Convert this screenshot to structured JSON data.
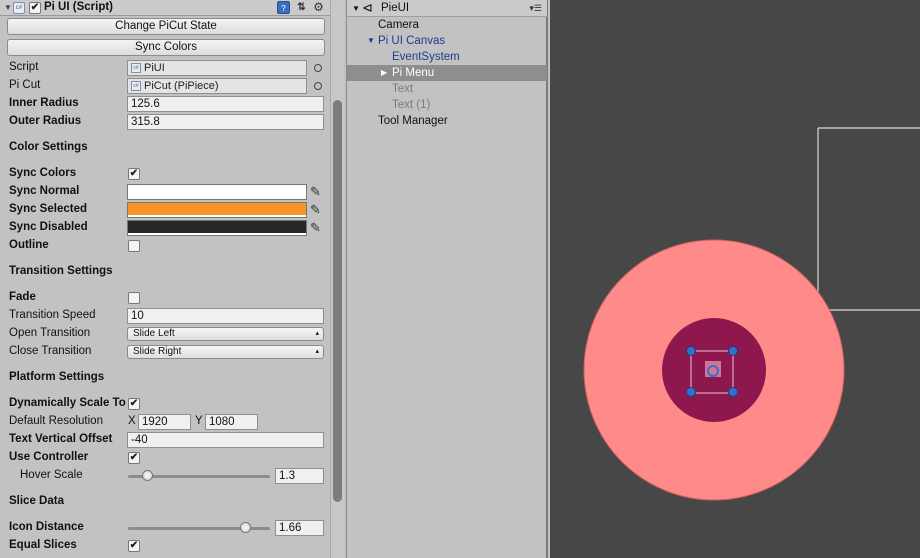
{
  "inspector": {
    "component_title": "Pi UI (Script)",
    "buttons": {
      "change_state": "Change PiCut State",
      "sync_colors": "Sync Colors"
    },
    "script": {
      "label": "Script",
      "value": "PiUI"
    },
    "picut": {
      "label": "Pi Cut",
      "value": "PiCut (PiPiece)"
    },
    "inner_radius": {
      "label": "Inner Radius",
      "value": "125.6"
    },
    "outer_radius": {
      "label": "Outer Radius",
      "value": "315.8"
    },
    "color_settings": {
      "header": "Color Settings",
      "sync_colors": {
        "label": "Sync Colors",
        "checked": true
      },
      "sync_normal": {
        "label": "Sync Normal",
        "color": "#ffffff"
      },
      "sync_selected": {
        "label": "Sync Selected",
        "color": "#f7952a"
      },
      "sync_disabled": {
        "label": "Sync Disabled",
        "color": "#262626"
      },
      "outline": {
        "label": "Outline",
        "checked": false
      }
    },
    "transition_settings": {
      "header": "Transition Settings",
      "fade": {
        "label": "Fade",
        "checked": false
      },
      "speed": {
        "label": "Transition Speed",
        "value": "10"
      },
      "open": {
        "label": "Open Transition",
        "value": "Slide Left"
      },
      "close": {
        "label": "Close Transition",
        "value": "Slide Right"
      }
    },
    "platform_settings": {
      "header": "Platform Settings",
      "dynamic_scale": {
        "label": "Dynamically Scale To",
        "checked": true
      },
      "default_resolution": {
        "label": "Default Resolution",
        "x_label": "X",
        "x": "1920",
        "y_label": "Y",
        "y": "1080"
      },
      "text_offset": {
        "label": "Text Vertical Offset",
        "value": "-40"
      },
      "use_controller": {
        "label": "Use Controller",
        "checked": true
      },
      "hover_scale": {
        "label": "Hover Scale",
        "value": "1.3",
        "fraction": 0.14
      }
    },
    "slice_data": {
      "header": "Slice Data",
      "icon_distance": {
        "label": "Icon Distance",
        "value": "1.66",
        "fraction": 0.83
      },
      "equal_slices": {
        "label": "Equal Slices",
        "checked": true
      }
    }
  },
  "hierarchy": {
    "scene_name": "PieUI",
    "items": [
      "Camera",
      "Pi UI Canvas",
      "EventSystem",
      "Pi Menu",
      "Text",
      "Text (1)",
      "Tool Manager"
    ],
    "selected": "Pi Menu"
  },
  "scene": {
    "background": "#474747",
    "outer_disc_color": "#ff8a8a",
    "inner_disc_color": "#8e174d",
    "handle_color": "#2f6fd0"
  }
}
